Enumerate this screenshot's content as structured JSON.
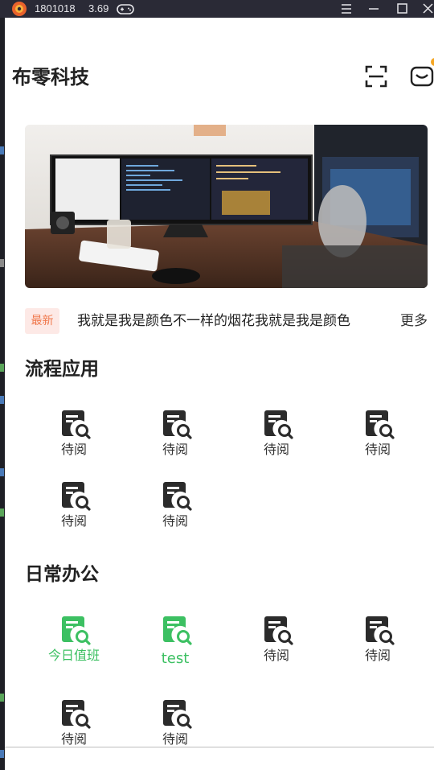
{
  "window": {
    "title": "1801018",
    "version": "3.69",
    "logo_icon": "app-logo-icon",
    "game_icon": "gamepad-icon"
  },
  "header": {
    "title": "布零科技",
    "scan_icon": "scan-icon",
    "message_icon": "message-icon",
    "has_unread": true
  },
  "banner": {
    "icon": "banner-photo-desk-monitors"
  },
  "notice": {
    "badge": "最新",
    "text": "我就是我是颜色不一样的烟花我就是我是颜色",
    "more": "更多"
  },
  "sections": [
    {
      "title": "流程应用",
      "items": [
        {
          "label": "待阅",
          "highlight": false
        },
        {
          "label": "待阅",
          "highlight": false
        },
        {
          "label": "待阅",
          "highlight": false
        },
        {
          "label": "待阅",
          "highlight": false
        },
        {
          "label": "待阅",
          "highlight": false
        },
        {
          "label": "待阅",
          "highlight": false
        }
      ]
    },
    {
      "title": "日常办公",
      "items": [
        {
          "label": "今日值班",
          "highlight": true
        },
        {
          "label": "test",
          "highlight": true
        },
        {
          "label": "待阅",
          "highlight": false
        },
        {
          "label": "待阅",
          "highlight": false
        },
        {
          "label": "待阅",
          "highlight": false
        },
        {
          "label": "待阅",
          "highlight": false
        }
      ]
    }
  ],
  "colors": {
    "accent_green": "#3cc062",
    "icon_dark": "#2b2b2b",
    "badge_bg": "#fde9e6",
    "badge_text": "#f07a4f",
    "unread_dot": "#f5a623"
  }
}
